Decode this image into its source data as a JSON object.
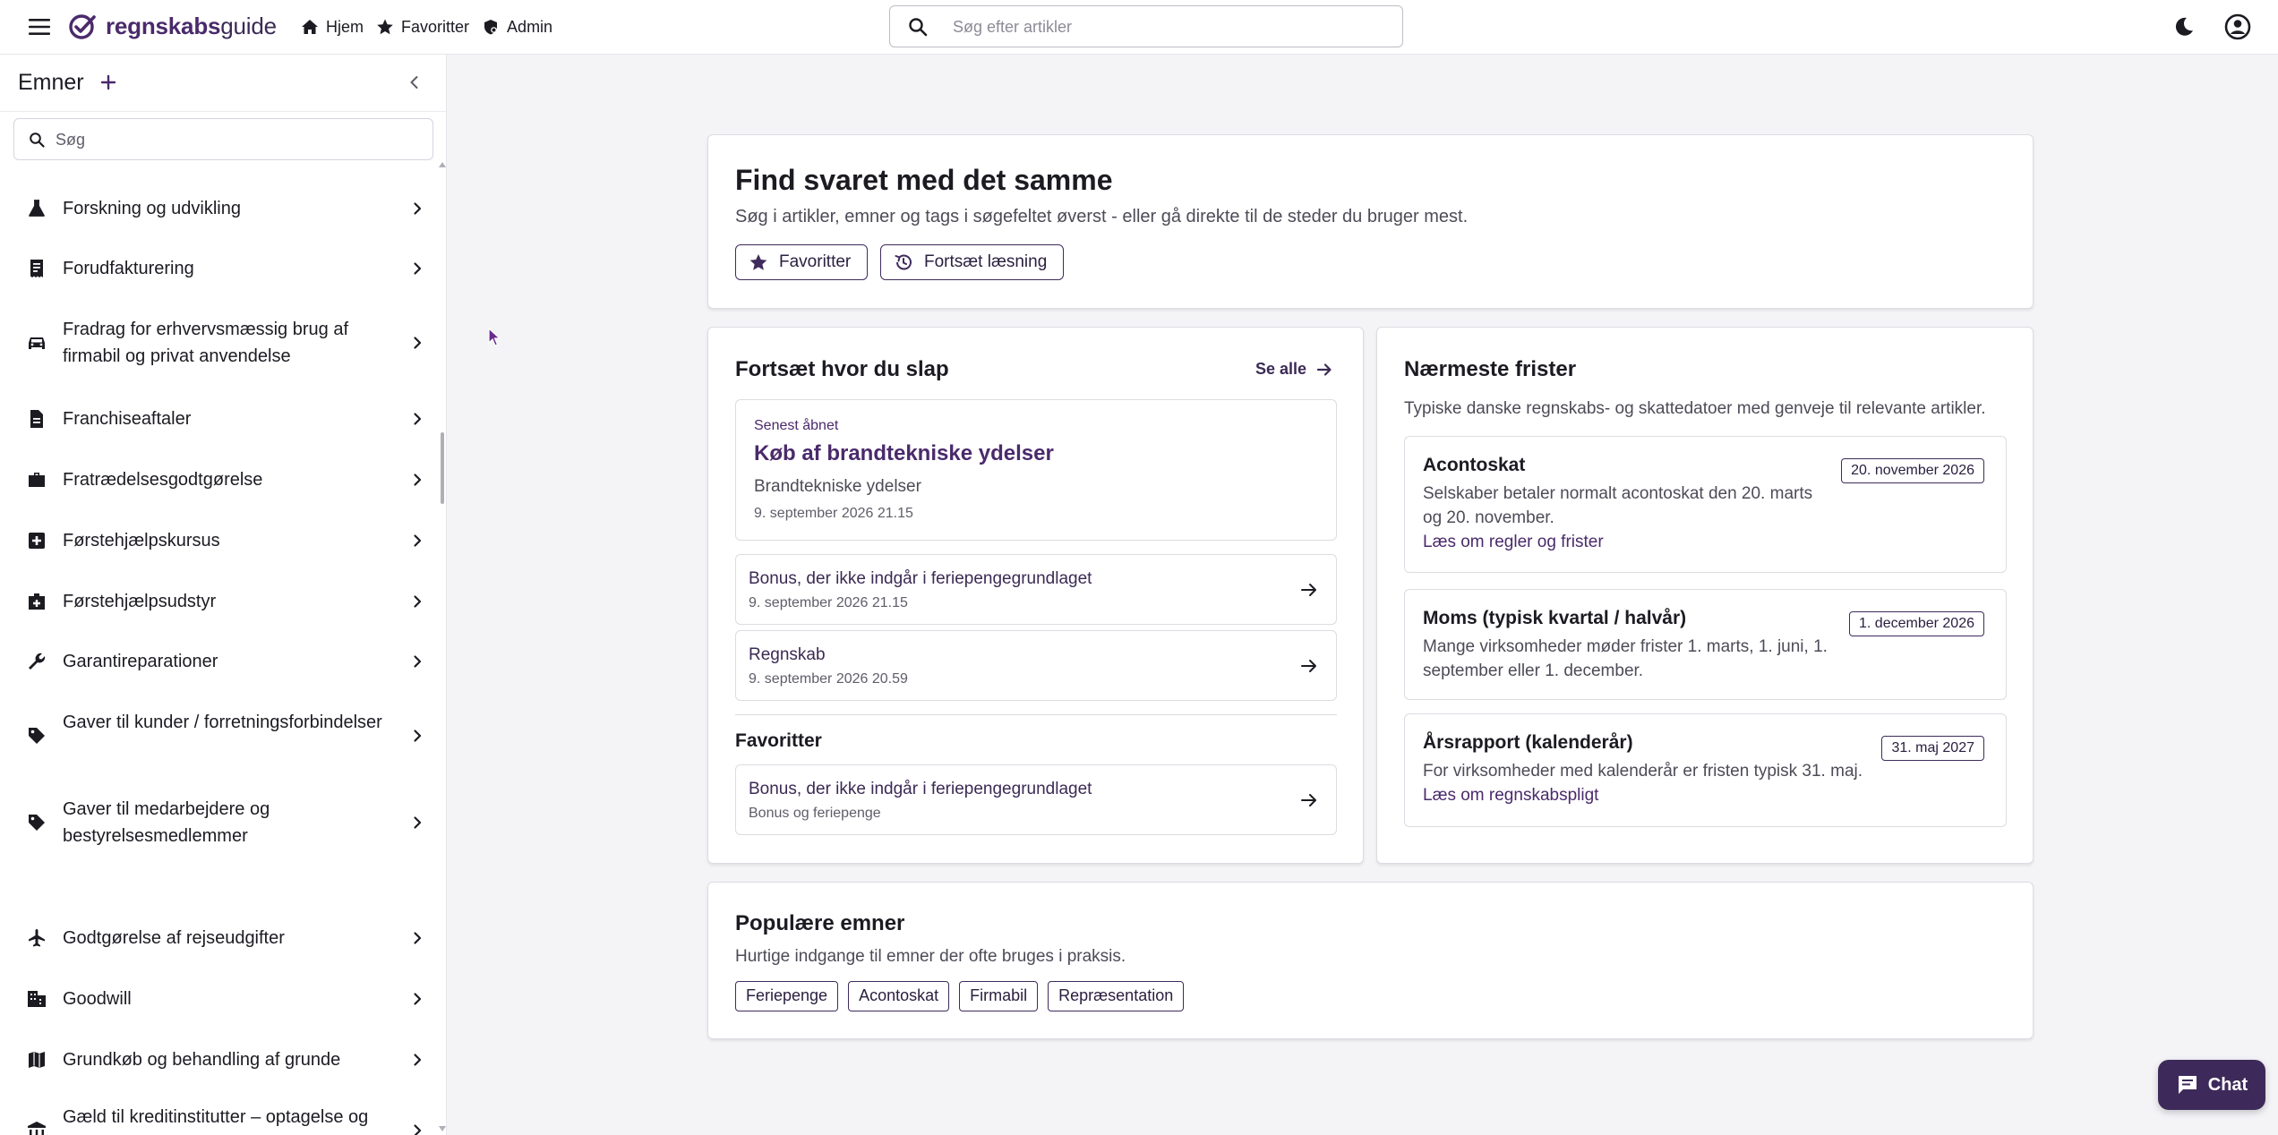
{
  "brand": {
    "name_bold": "regnskabs",
    "name_rest": "guide",
    "accent": "#4a2a6b"
  },
  "topnav": [
    {
      "label": "Hjem",
      "icon": "home-icon"
    },
    {
      "label": "Favoritter",
      "icon": "star-icon"
    },
    {
      "label": "Admin",
      "icon": "admin-icon"
    }
  ],
  "search": {
    "placeholder": "Søg efter artikler"
  },
  "sidebar": {
    "title": "Emner",
    "search_placeholder": "Søg",
    "topics": [
      {
        "label": "Forskning og udvikling",
        "icon": "flask-icon"
      },
      {
        "label": "Forudfakturering",
        "icon": "receipt-icon"
      },
      {
        "label": "Fradrag for erhvervsmæssig brug af firmabil og privat anvendelse",
        "icon": "car-icon"
      },
      {
        "label": "Franchiseaftaler",
        "icon": "document-icon"
      },
      {
        "label": "Fratrædelsesgodtgørelse",
        "icon": "briefcase-icon"
      },
      {
        "label": "Førstehjælpskursus",
        "icon": "medical-plus-icon"
      },
      {
        "label": "Førstehjælpsudstyr",
        "icon": "medkit-icon"
      },
      {
        "label": "Garantireparationer",
        "icon": "wrench-icon"
      },
      {
        "label": "Gaver til kunder / forretningsforbindelser",
        "icon": "tag-icon"
      },
      {
        "label": "Gaver til medarbejdere og bestyrelsesmedlemmer",
        "icon": "tag-icon"
      },
      {
        "label": "Godtgørelse af rejseudgifter",
        "icon": "airplane-icon"
      },
      {
        "label": "Goodwill",
        "icon": "building-icon"
      },
      {
        "label": "Grundkøb og behandling af grunde",
        "icon": "map-icon"
      },
      {
        "label": "Gæld til kreditinstitutter – optagelse og afvikling",
        "icon": "bank-icon"
      }
    ]
  },
  "hero": {
    "title": "Find svaret med det samme",
    "subtitle": "Søg i artikler, emner og tags i søgefeltet øverst - eller gå direkte til de steder du bruger mest.",
    "buttons": {
      "favorites": "Favoritter",
      "continue": "Fortsæt læsning"
    }
  },
  "continue": {
    "title": "Fortsæt hvor du slap",
    "see_all": "Se alle",
    "latest": {
      "kicker": "Senest åbnet",
      "title": "Køb af brandtekniske ydelser",
      "category": "Brandtekniske ydelser",
      "date": "9. september 2026 21.15"
    },
    "recent": [
      {
        "title": "Bonus, der ikke indgår i feriepengegrundlaget",
        "sub": "9. september 2026 21.15"
      },
      {
        "title": "Regnskab",
        "sub": "9. september 2026 20.59"
      }
    ],
    "favorites_title": "Favoritter",
    "favorites": [
      {
        "title": "Bonus, der ikke indgår i feriepengegrundlaget",
        "sub": "Bonus og feriepenge"
      }
    ]
  },
  "deadlines": {
    "title": "Nærmeste frister",
    "description": "Typiske danske regnskabs- og skattedatoer med genveje til relevante artikler.",
    "items": [
      {
        "title": "Acontoskat",
        "text": "Selskaber betaler normalt acontoskat den 20. marts og 20. november.",
        "link": "Læs om regler og frister",
        "date": "20. november 2026"
      },
      {
        "title": "Moms (typisk kvartal / halvår)",
        "text": "Mange virksomheder møder frister 1. marts, 1. juni, 1. september eller 1. december.",
        "link": "",
        "date": "1. december 2026"
      },
      {
        "title": "Årsrapport (kalenderår)",
        "text": "For virksomheder med kalenderår er fristen typisk 31. maj.",
        "link": "Læs om regnskabspligt",
        "date": "31. maj 2027"
      }
    ]
  },
  "popular": {
    "title": "Populære emner",
    "description": "Hurtige indgange til emner der ofte bruges i praksis.",
    "tags": [
      "Feriepenge",
      "Acontoskat",
      "Firmabil",
      "Repræsentation"
    ]
  },
  "chat": {
    "label": "Chat"
  }
}
